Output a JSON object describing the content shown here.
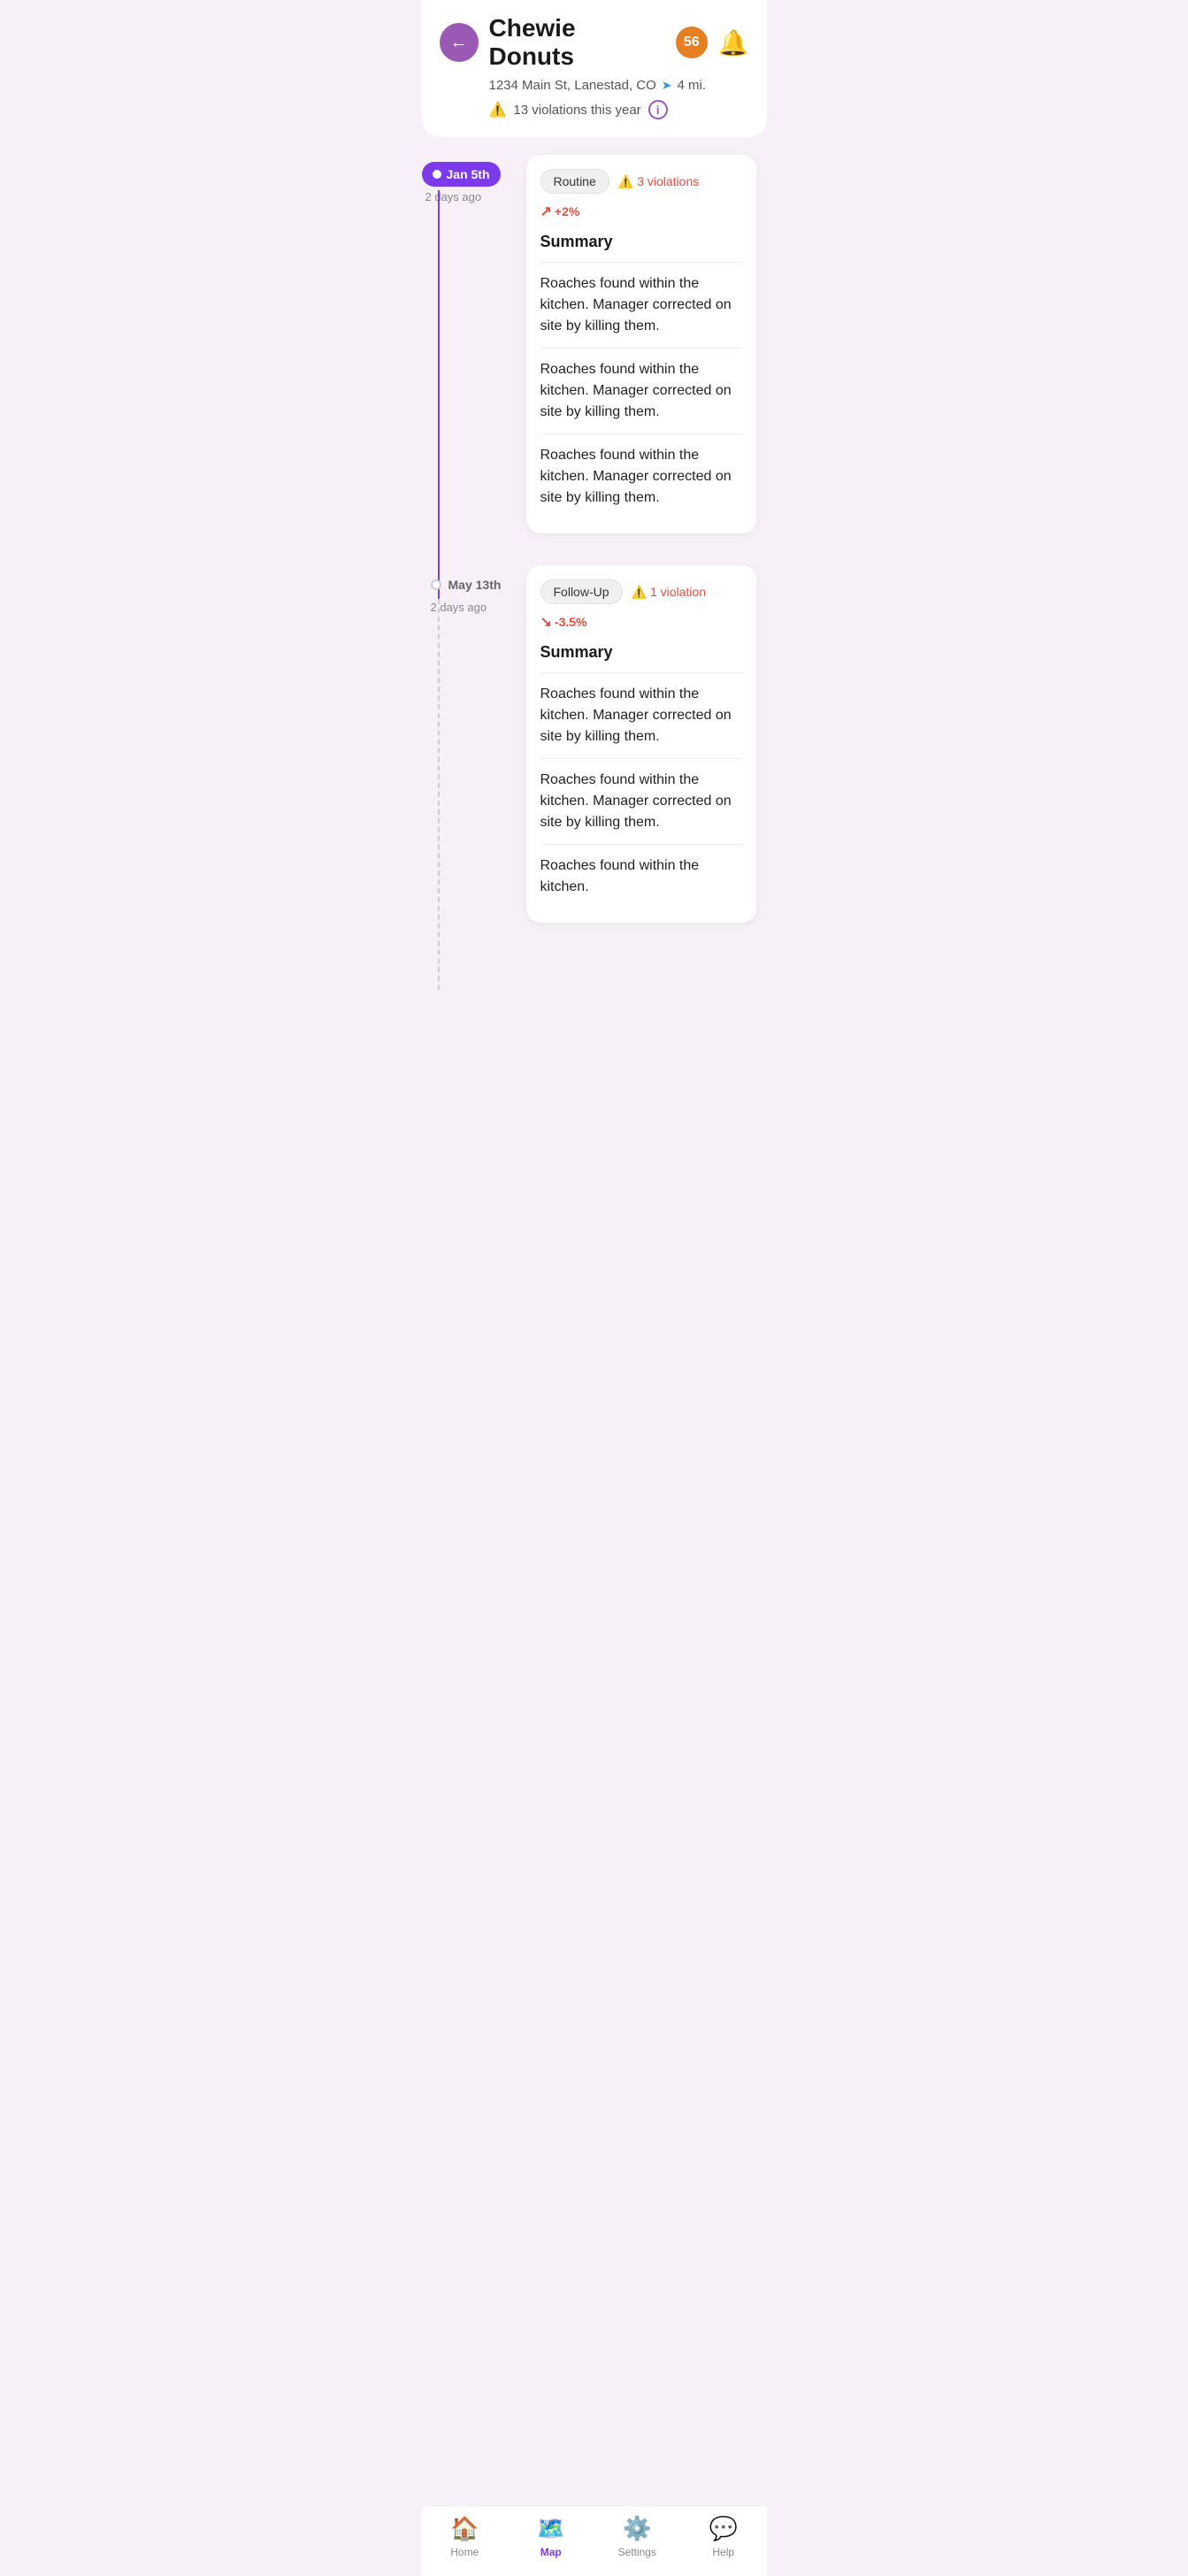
{
  "header": {
    "restaurant_name": "Chewie Donuts",
    "violation_count": "56",
    "address": "1234 Main St, Lanestad, CO",
    "distance": "4 mi.",
    "yearly_violations": "13 violations this year"
  },
  "timeline": [
    {
      "date_label": "Jan 5th",
      "time_ago": "2 days ago",
      "active": true,
      "inspections": [
        {
          "type": "Routine",
          "violations_count": "3 violations",
          "trend": "+2%",
          "trend_direction": "up",
          "summary_title": "Summary",
          "items": [
            "Roaches found within the kitchen. Manager corrected on site by killing them.",
            "Roaches found within the kitchen. Manager corrected on site by killing them.",
            "Roaches found within the kitchen. Manager corrected on site by killing them."
          ]
        }
      ]
    },
    {
      "date_label": "May 13th",
      "time_ago": "2 days ago",
      "active": false,
      "inspections": [
        {
          "type": "Follow-Up",
          "violations_count": "1 violation",
          "trend": "-3.5%",
          "trend_direction": "down",
          "summary_title": "Summary",
          "items": [
            "Roaches found within the kitchen. Manager corrected on site by killing them.",
            "Roaches found within the kitchen. Manager corrected on site by killing them.",
            "Roaches found within the kitchen."
          ]
        }
      ]
    }
  ],
  "nav": {
    "items": [
      {
        "label": "Home",
        "icon": "🏠",
        "active": false
      },
      {
        "label": "Map",
        "icon": "🗺",
        "active": true
      },
      {
        "label": "Settings",
        "icon": "⚙️",
        "active": false
      },
      {
        "label": "Help",
        "icon": "💬",
        "active": false
      }
    ]
  }
}
